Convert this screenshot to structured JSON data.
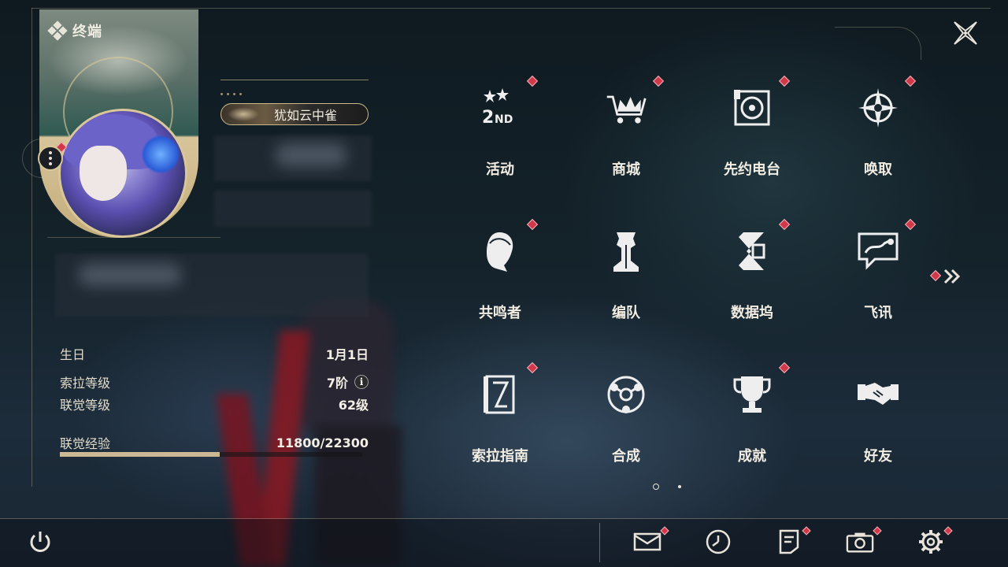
{
  "header": {
    "title": "终端"
  },
  "profile": {
    "nickname": "犹如云中雀"
  },
  "stats": {
    "birthday_label": "生日",
    "birthday_value": "1月1日",
    "sola_level_label": "索拉等级",
    "sola_level_value": "7阶",
    "union_level_label": "联觉等级",
    "union_level_value": "62级",
    "union_exp_label": "联觉经验",
    "union_exp_value": "11800/22300",
    "union_exp_progress": 0.529
  },
  "menu": {
    "items": [
      {
        "label": "活动",
        "icon": "event-2nd-anniversary-icon",
        "badge": true
      },
      {
        "label": "商城",
        "icon": "shop-crown-cart-icon",
        "badge": true
      },
      {
        "label": "先约电台",
        "icon": "radio-pass-icon",
        "badge": true
      },
      {
        "label": "唤取",
        "icon": "convene-compass-icon",
        "badge": true
      },
      {
        "label": "共鸣者",
        "icon": "resonator-head-icon",
        "badge": true
      },
      {
        "label": "编队",
        "icon": "team-chess-icon",
        "badge": false
      },
      {
        "label": "数据坞",
        "icon": "data-bank-icon",
        "badge": true
      },
      {
        "label": "飞讯",
        "icon": "messages-chat-icon",
        "badge": true
      },
      {
        "label": "索拉指南",
        "icon": "solaris-guide-icon",
        "badge": true
      },
      {
        "label": "合成",
        "icon": "synthesis-icon",
        "badge": false
      },
      {
        "label": "成就",
        "icon": "achievement-trophy-icon",
        "badge": true
      },
      {
        "label": "好友",
        "icon": "friends-handshake-icon",
        "badge": false
      }
    ],
    "page_count": 2,
    "current_page": 1
  },
  "bottom_bar": {
    "buttons": [
      "power-icon",
      "mail-icon",
      "history-clock-icon",
      "notice-board-icon",
      "camera-icon",
      "settings-gear-icon"
    ]
  },
  "colors": {
    "accent_gold": "#cdb896",
    "badge_red": "#d3384a",
    "text": "#f2ede2"
  }
}
